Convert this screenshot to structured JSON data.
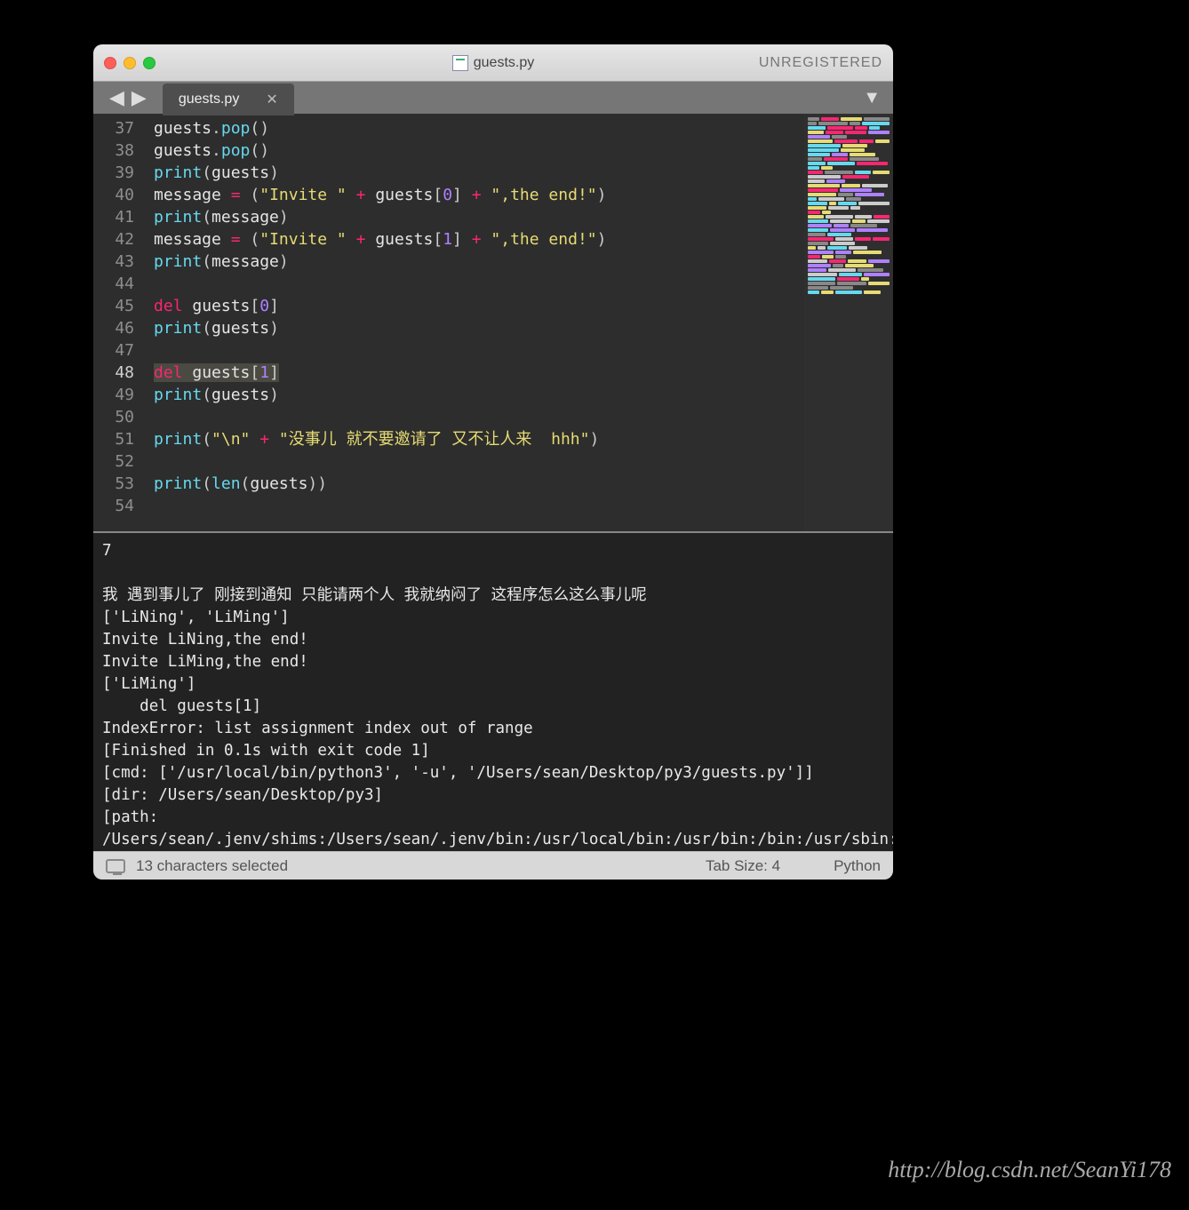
{
  "window": {
    "title": "guests.py",
    "registration": "UNREGISTERED"
  },
  "tab": {
    "name": "guests.py"
  },
  "gutter_start": 37,
  "highlighted_line": 48,
  "code_lines": [
    {
      "n": 37,
      "segs": [
        [
          "id",
          "guests"
        ],
        [
          "punc",
          "."
        ],
        [
          "fn",
          "pop"
        ],
        [
          "punc",
          "()"
        ]
      ]
    },
    {
      "n": 38,
      "segs": [
        [
          "id",
          "guests"
        ],
        [
          "punc",
          "."
        ],
        [
          "fn",
          "pop"
        ],
        [
          "punc",
          "()"
        ]
      ]
    },
    {
      "n": 39,
      "segs": [
        [
          "fn",
          "print"
        ],
        [
          "punc",
          "("
        ],
        [
          "id",
          "guests"
        ],
        [
          "punc",
          ")"
        ]
      ]
    },
    {
      "n": 40,
      "segs": [
        [
          "id",
          "message "
        ],
        [
          "kw",
          "="
        ],
        [
          "punc",
          " ("
        ],
        [
          "str",
          "\"Invite \""
        ],
        [
          "punc",
          " "
        ],
        [
          "kw",
          "+"
        ],
        [
          "punc",
          " "
        ],
        [
          "id",
          "guests"
        ],
        [
          "punc",
          "["
        ],
        [
          "num",
          "0"
        ],
        [
          "punc",
          "] "
        ],
        [
          "kw",
          "+"
        ],
        [
          "punc",
          " "
        ],
        [
          "str",
          "\",the end!\""
        ],
        [
          "punc",
          ")"
        ]
      ]
    },
    {
      "n": 41,
      "segs": [
        [
          "fn",
          "print"
        ],
        [
          "punc",
          "("
        ],
        [
          "id",
          "message"
        ],
        [
          "punc",
          ")"
        ]
      ]
    },
    {
      "n": 42,
      "segs": [
        [
          "id",
          "message "
        ],
        [
          "kw",
          "="
        ],
        [
          "punc",
          " ("
        ],
        [
          "str",
          "\"Invite \""
        ],
        [
          "punc",
          " "
        ],
        [
          "kw",
          "+"
        ],
        [
          "punc",
          " "
        ],
        [
          "id",
          "guests"
        ],
        [
          "punc",
          "["
        ],
        [
          "num",
          "1"
        ],
        [
          "punc",
          "] "
        ],
        [
          "kw",
          "+"
        ],
        [
          "punc",
          " "
        ],
        [
          "str",
          "\",the end!\""
        ],
        [
          "punc",
          ")"
        ]
      ]
    },
    {
      "n": 43,
      "segs": [
        [
          "fn",
          "print"
        ],
        [
          "punc",
          "("
        ],
        [
          "id",
          "message"
        ],
        [
          "punc",
          ")"
        ]
      ]
    },
    {
      "n": 44,
      "segs": []
    },
    {
      "n": 45,
      "segs": [
        [
          "kw",
          "del"
        ],
        [
          "punc",
          " "
        ],
        [
          "id",
          "guests"
        ],
        [
          "punc",
          "["
        ],
        [
          "num",
          "0"
        ],
        [
          "punc",
          "]"
        ]
      ]
    },
    {
      "n": 46,
      "segs": [
        [
          "fn",
          "print"
        ],
        [
          "punc",
          "("
        ],
        [
          "id",
          "guests"
        ],
        [
          "punc",
          ")"
        ]
      ]
    },
    {
      "n": 47,
      "segs": []
    },
    {
      "n": 48,
      "selected": true,
      "segs": [
        [
          "kw",
          "del"
        ],
        [
          "punc",
          " "
        ],
        [
          "id",
          "guests"
        ],
        [
          "punc",
          "["
        ],
        [
          "num",
          "1"
        ],
        [
          "punc",
          "]"
        ]
      ]
    },
    {
      "n": 49,
      "segs": [
        [
          "fn",
          "print"
        ],
        [
          "punc",
          "("
        ],
        [
          "id",
          "guests"
        ],
        [
          "punc",
          ")"
        ]
      ]
    },
    {
      "n": 50,
      "segs": []
    },
    {
      "n": 51,
      "segs": [
        [
          "fn",
          "print"
        ],
        [
          "punc",
          "("
        ],
        [
          "str",
          "\"\\n\""
        ],
        [
          "punc",
          " "
        ],
        [
          "kw",
          "+"
        ],
        [
          "punc",
          " "
        ],
        [
          "str",
          "\"没事儿 就不要邀请了 又不让人来  hhh\""
        ],
        [
          "punc",
          ")"
        ]
      ]
    },
    {
      "n": 52,
      "segs": []
    },
    {
      "n": 53,
      "segs": [
        [
          "fn",
          "print"
        ],
        [
          "punc",
          "("
        ],
        [
          "fn",
          "len"
        ],
        [
          "punc",
          "("
        ],
        [
          "id",
          "guests"
        ],
        [
          "punc",
          "))"
        ]
      ]
    },
    {
      "n": 54,
      "segs": []
    }
  ],
  "output_lines": [
    "7",
    "",
    "我 遇到事儿了 刚接到通知 只能请两个人 我就纳闷了 这程序怎么这么事儿呢",
    "['LiNing', 'LiMing']",
    "Invite LiNing,the end!",
    "Invite LiMing,the end!",
    "['LiMing']",
    "    del guests[1]",
    "IndexError: list assignment index out of range",
    "[Finished in 0.1s with exit code 1]",
    "[cmd: ['/usr/local/bin/python3', '-u', '/Users/sean/Desktop/py3/guests.py']]",
    "[dir: /Users/sean/Desktop/py3]",
    "[path: /Users/sean/.jenv/shims:/Users/sean/.jenv/bin:/usr/local/bin:/usr/bin:/bin:/usr/sbin:/sbin]"
  ],
  "status": {
    "selection": "13 characters selected",
    "tab_size": "Tab Size: 4",
    "syntax": "Python"
  },
  "watermark": "http://blog.csdn.net/SeanYi178"
}
